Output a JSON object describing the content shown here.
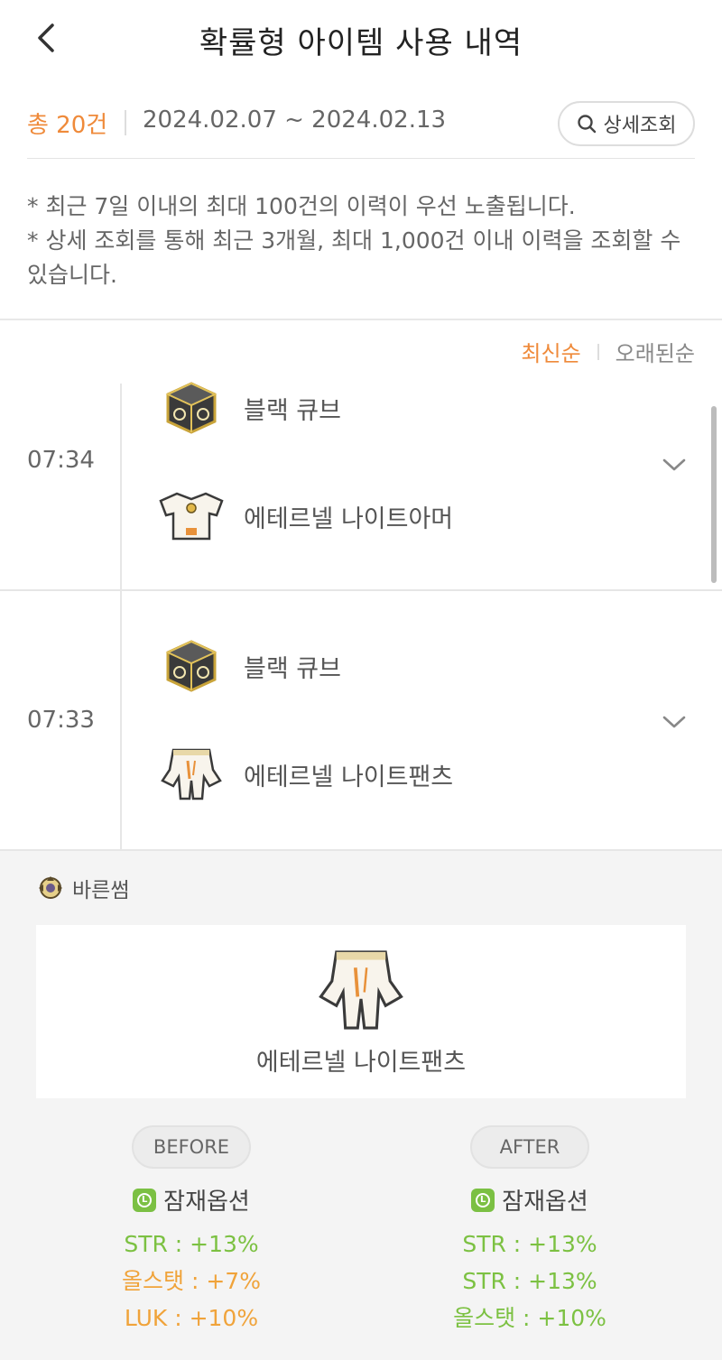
{
  "header": {
    "title": "확률형 아이템 사용 내역"
  },
  "summary": {
    "total": "총 20건",
    "range": "2024.02.07 ~ 2024.02.13",
    "detail_button": "상세조회"
  },
  "notes": [
    "* 최근 7일 이내의 최대 100건의 이력이 우선 노출됩니다.",
    "* 상세 조회를 통해 최근 3개월, 최대 1,000건 이내 이력을 조회할 수 있습니다."
  ],
  "sort": {
    "latest": "최신순",
    "oldest": "오래된순",
    "selected": "최신순"
  },
  "entries": [
    {
      "time": "07:34",
      "cube_name": "블랙 큐브",
      "item_name": "에테르넬 나이트아머",
      "item_icon": "armor-icon"
    },
    {
      "time": "07:33",
      "cube_name": "블랙 큐브",
      "item_name": "에테르넬 나이트팬츠",
      "item_icon": "pants-icon"
    }
  ],
  "detail": {
    "character": "바른썸",
    "item_name": "에테르넬 나이트팬츠",
    "before": {
      "label": "BEFORE",
      "option_title": "잠재옵션",
      "options": [
        {
          "text": "STR : +13%",
          "color": "#7cc142"
        },
        {
          "text": "올스탯 : +7%",
          "color": "#f0a33a"
        },
        {
          "text": "LUK : +10%",
          "color": "#f0a33a"
        }
      ]
    },
    "after": {
      "label": "AFTER",
      "option_title": "잠재옵션",
      "options": [
        {
          "text": "STR : +13%",
          "color": "#7cc142"
        },
        {
          "text": "STR : +13%",
          "color": "#7cc142"
        },
        {
          "text": "올스탯 : +10%",
          "color": "#7cc142"
        }
      ]
    }
  },
  "colors": {
    "accent": "#ef8a3a",
    "legendary": "#7bc043"
  }
}
